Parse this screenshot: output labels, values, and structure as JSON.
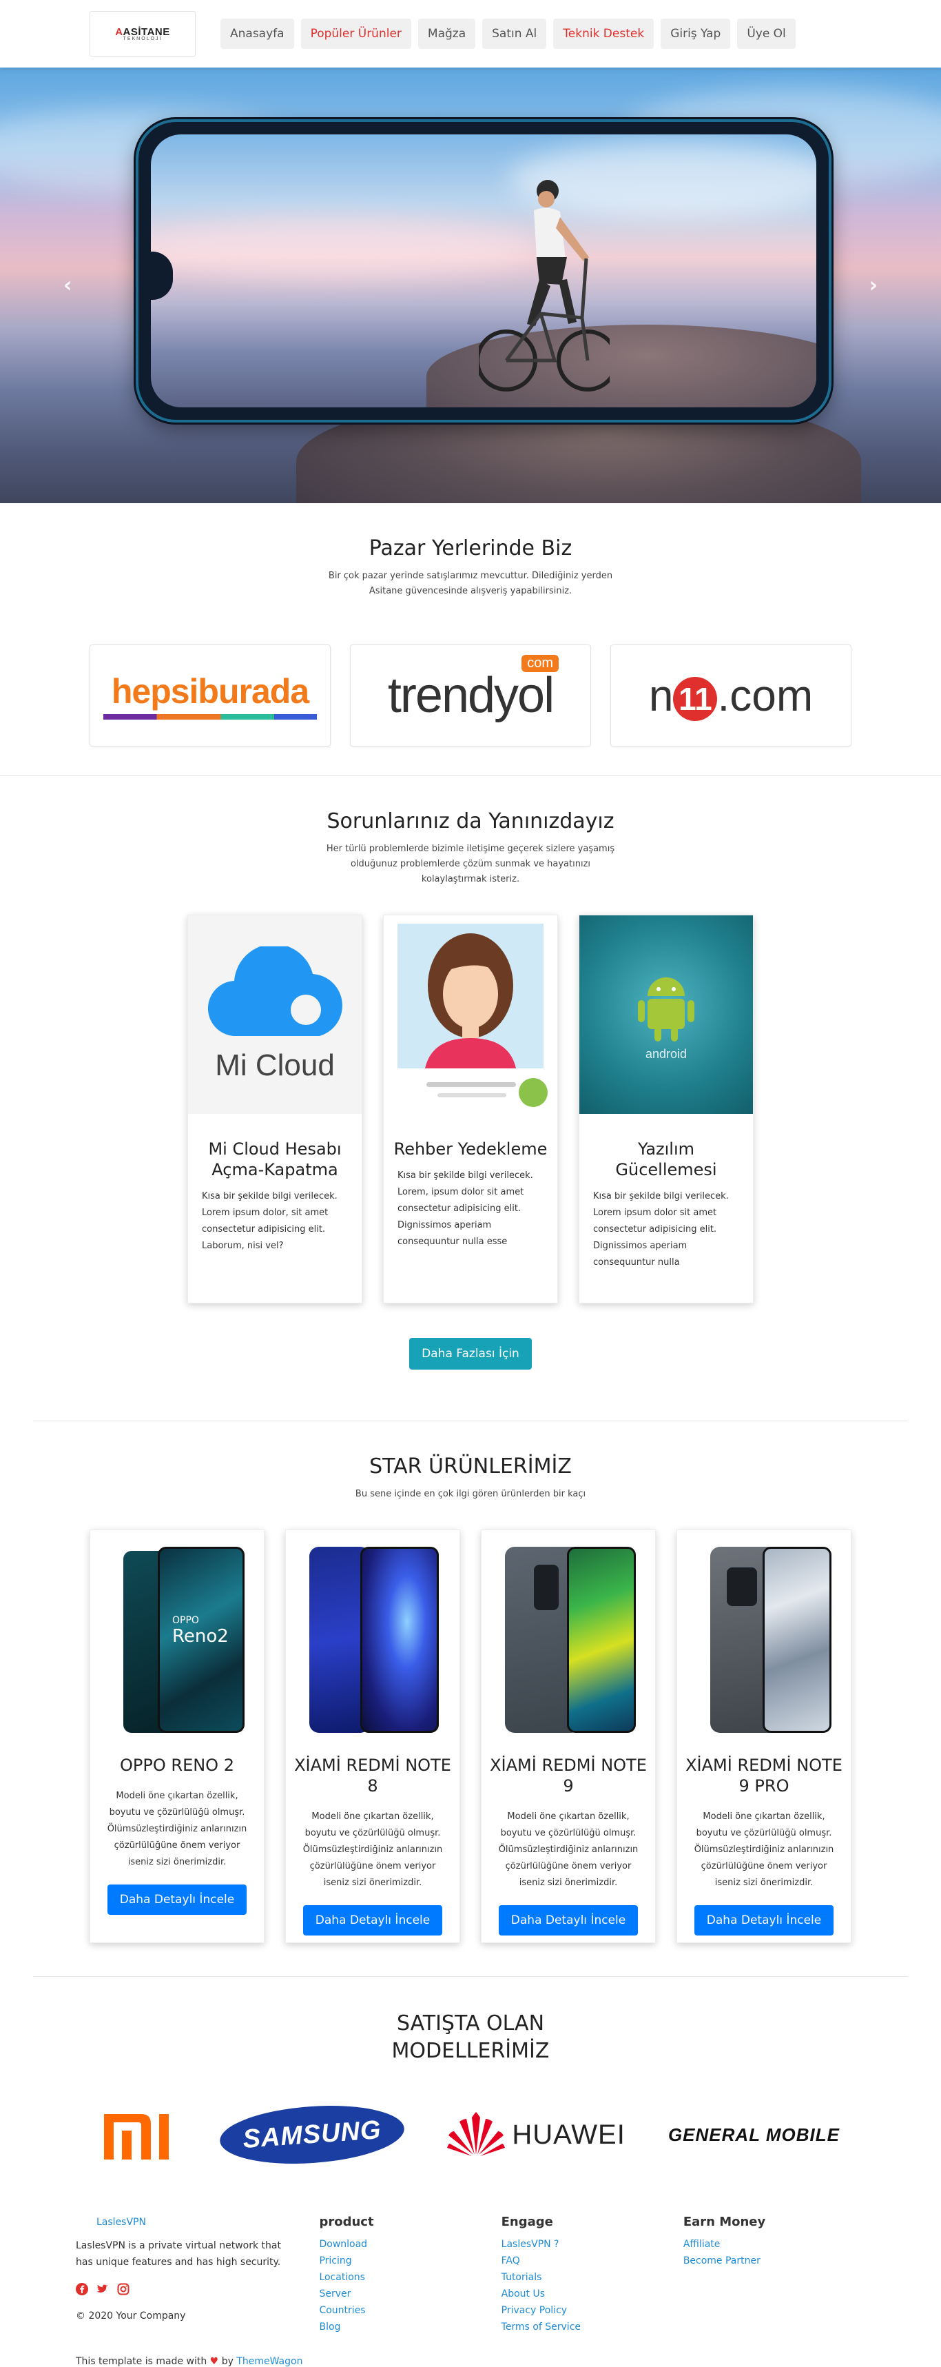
{
  "navbar": {
    "logo_main": "ASİTANE",
    "logo_sub": "TEKNOLOJİ",
    "items": [
      {
        "label": "Anasayfa",
        "accent": false
      },
      {
        "label": "Popüler Ürünler",
        "accent": true
      },
      {
        "label": "Mağza",
        "accent": false
      },
      {
        "label": "Satın Al",
        "accent": false
      },
      {
        "label": "Teknik Destek",
        "accent": true
      },
      {
        "label": "Giriş Yap",
        "accent": false
      },
      {
        "label": "Üye Ol",
        "accent": false
      }
    ]
  },
  "hero": {
    "prev_icon": "chevron-left",
    "next_icon": "chevron-right"
  },
  "markets": {
    "title": "Pazar Yerlerinde Biz",
    "subtitle": "Bir çok pazar yerinde satışlarımız mevcuttur. Dilediğiniz yerden Asitane güvencesinde alışveriş yapabilirsiniz.",
    "logos": [
      {
        "text": "hepsiburada"
      },
      {
        "text": "trendyol",
        "badge": "com"
      },
      {
        "text_n": "n",
        "text_11": "11",
        "text_rest": ".com"
      }
    ]
  },
  "support": {
    "title": "Sorunlarınız da Yanınızdayız",
    "subtitle": "Her türlü problemlerde bizimle iletişime geçerek sizlere yaşamış olduğunuz problemlerde çözüm sunmak ve hayatınızı kolaylaştırmak isteriz.",
    "cards": [
      {
        "image_text": "Mi Cloud",
        "title": "Mi Cloud Hesabı Açma-Kapatma",
        "text": "Kısa bir şekilde bilgi verilecek. Lorem ipsum dolor, sit amet consectetur adipisicing elit. Laborum, nisi vel?"
      },
      {
        "title": "Rehber Yedekleme",
        "text": "Kısa bir şekilde bilgi verilecek. Lorem, ipsum dolor sit amet consectetur adipisicing elit. Dignissimos aperiam consequuntur nulla esse"
      },
      {
        "image_text": "android",
        "title": "Yazılım Gücellemesi",
        "text": "Kısa bir şekilde bilgi verilecek. Lorem ipsum dolor sit amet consectetur adipisicing elit. Dignissimos aperiam consequuntur nulla"
      }
    ],
    "button": "Daha Fazlası İçin"
  },
  "products": {
    "title": "STAR ÜRÜNLERİMİZ",
    "subtitle": "Bu sene içinde en çok ilgi gören ürünlerden bir kaçı",
    "items": [
      {
        "name": "OPPO RENO 2",
        "image_text_1": "OPPO",
        "image_text_2": "Reno2",
        "text": "Modeli öne çıkartan özellik, boyutu ve çözürlülüğü olmuşr. Ölümsüzleştirdiğiniz anlarınızın çözürlülüğüne önem veriyor iseniz sizi önerimizdir.",
        "button": "Daha Detaylı İncele"
      },
      {
        "name": "XİAMİ REDMİ NOTE 8",
        "text": "Modeli öne çıkartan özellik, boyutu ve çözürlülüğü olmuşr. Ölümsüzleştirdiğiniz anlarınızın çözürlülüğüne önem veriyor iseniz sizi önerimizdir.",
        "button": "Daha Detaylı İncele"
      },
      {
        "name": "XİAMİ REDMİ NOTE 9",
        "text": "Modeli öne çıkartan özellik, boyutu ve çözürlülüğü olmuşr. Ölümsüzleştirdiğiniz anlarınızın çözürlülüğüne önem veriyor iseniz sizi önerimizdir.",
        "button": "Daha Detaylı İncele"
      },
      {
        "name": "XİAMİ REDMİ NOTE 9 PRO",
        "text": "Modeli öne çıkartan özellik, boyutu ve çözürlülüğü olmuşr. Ölümsüzleştirdiğiniz anlarınızın çözürlülüğüne önem veriyor iseniz sizi önerimizdir.",
        "button": "Daha Detaylı İncele"
      }
    ]
  },
  "brands": {
    "title": "SATIŞTA OLAN MODELLERİMİZ",
    "logos": [
      "mi",
      "SAMSUNG",
      "HUAWEI",
      "GENERAL MOBILE"
    ]
  },
  "footer": {
    "brand_link": "LaslesVPN",
    "description": "LaslesVPN is a private virtual network that has unique features and has high security.",
    "social_icons": [
      "facebook-icon",
      "twitter-icon",
      "instagram-icon"
    ],
    "copyright": "© 2020 Your Company",
    "columns": [
      {
        "title": "product",
        "links": [
          "Download",
          "Pricing",
          "Locations",
          "Server",
          "Countries",
          "Blog"
        ]
      },
      {
        "title": "Engage",
        "links": [
          "LaslesVPN ?",
          "FAQ",
          "Tutorials",
          "About Us",
          "Privacy Policy",
          "Terms of Service"
        ]
      },
      {
        "title": "Earn Money",
        "links": [
          "Affiliate",
          "Become Partner"
        ]
      }
    ],
    "credit_prefix": "This template is made with",
    "credit_by": "by",
    "credit_link": "ThemeWagon"
  },
  "colors": {
    "accent_red": "#e0302d",
    "teal": "#17a2b8",
    "primary_blue": "#007bff",
    "link_blue": "#1e8bd6"
  }
}
